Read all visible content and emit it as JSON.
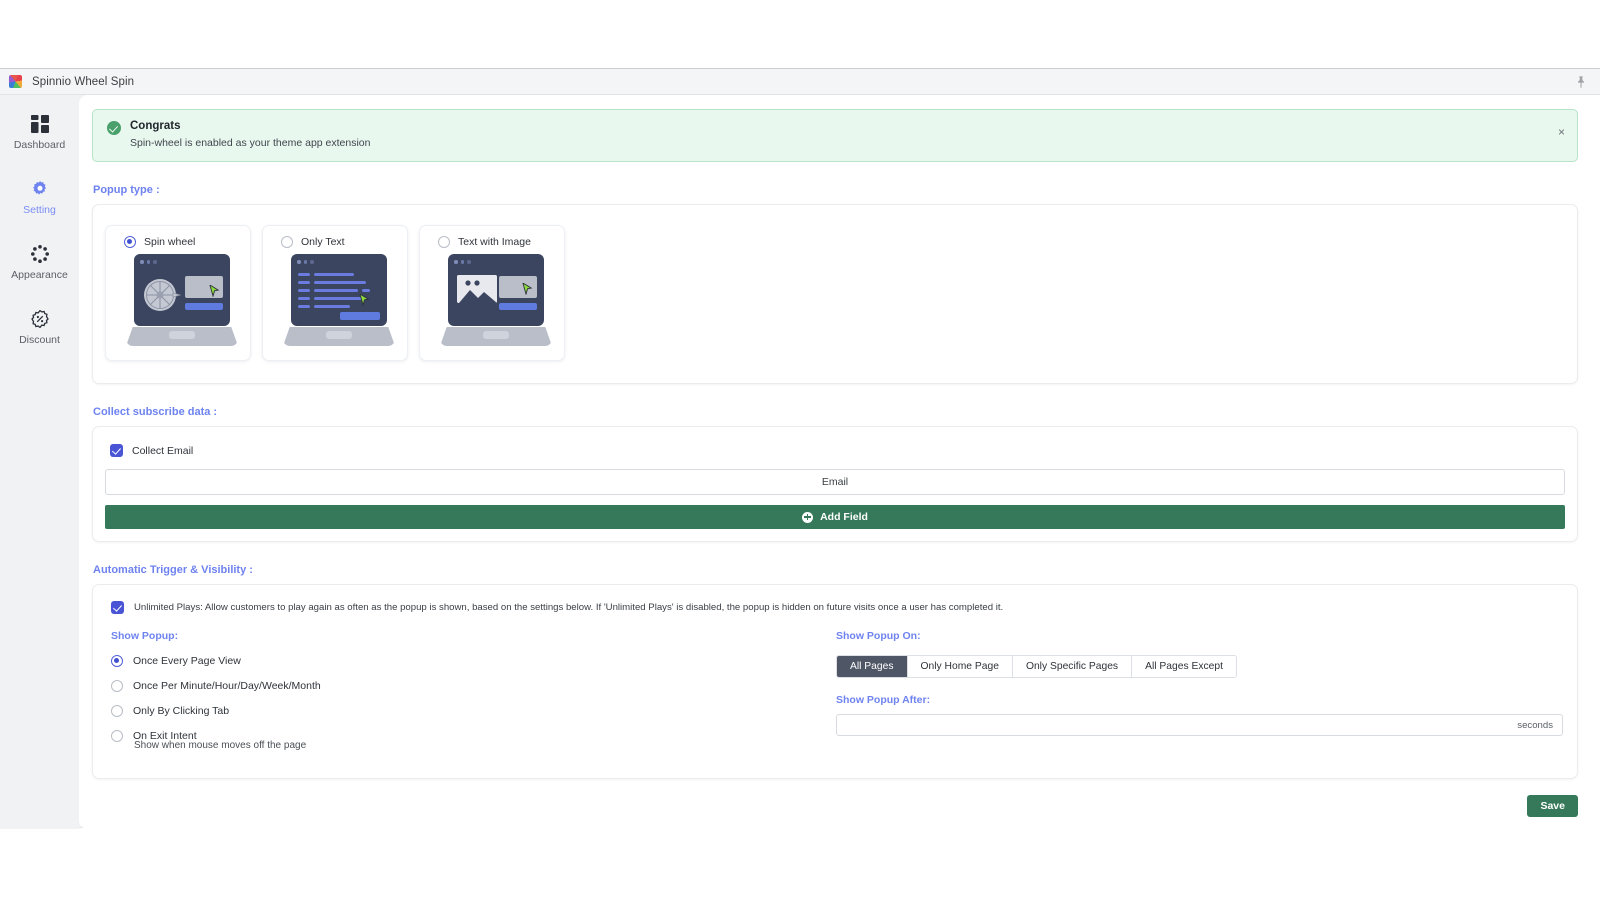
{
  "window": {
    "app_title": "Spinnio Wheel Spin",
    "logo_icon": "spinnio-logo-icon",
    "pin_icon": "pin-icon"
  },
  "sidebar": {
    "items": [
      {
        "label": "Dashboard",
        "icon": "dashboard-grid-icon",
        "active": false
      },
      {
        "label": "Setting",
        "icon": "gear-icon",
        "active": true
      },
      {
        "label": "Appearance",
        "icon": "appearance-dots-icon",
        "active": false
      },
      {
        "label": "Discount",
        "icon": "discount-badge-icon",
        "active": false
      }
    ]
  },
  "banner": {
    "icon": "success-check-icon",
    "title": "Congrats",
    "subtitle": "Spin-wheel is enabled as your theme app extension",
    "close_label": "×"
  },
  "popup_type": {
    "heading": "Popup type :",
    "options": [
      {
        "label": "Spin wheel",
        "selected": true,
        "illustration": "laptop-spin-wheel"
      },
      {
        "label": "Only Text",
        "selected": false,
        "illustration": "laptop-only-text"
      },
      {
        "label": "Text with Image",
        "selected": false,
        "illustration": "laptop-text-with-image"
      }
    ]
  },
  "collect": {
    "heading": "Collect subscribe data :",
    "collect_email_label": "Collect Email",
    "collect_email_checked": true,
    "email_field_value": "Email",
    "add_field_label": "Add Field",
    "add_field_icon": "plus-circle-icon"
  },
  "trigger": {
    "heading": "Automatic Trigger & Visibility :",
    "unlimited_checked": true,
    "unlimited_text": "Unlimited Plays: Allow customers to play again as often as the popup is shown, based on the settings below. If 'Unlimited Plays' is disabled, the popup is hidden on future visits once a user has completed it.",
    "show_popup_label": "Show Popup:",
    "show_popup_options": [
      {
        "label": "Once Every Page View",
        "selected": true
      },
      {
        "label": "Once Per Minute/Hour/Day/Week/Month",
        "selected": false
      },
      {
        "label": "Only By Clicking Tab",
        "selected": false
      },
      {
        "label": "On Exit Intent",
        "selected": false
      }
    ],
    "exit_intent_hint": "Show when mouse moves off the page",
    "show_popup_on_label": "Show Popup On:",
    "show_popup_on_options": [
      {
        "label": "All Pages",
        "active": true
      },
      {
        "label": "Only Home Page",
        "active": false
      },
      {
        "label": "Only Specific Pages",
        "active": false
      },
      {
        "label": "All Pages Except",
        "active": false
      }
    ],
    "show_popup_after_label": "Show Popup After:",
    "show_popup_after_value": "",
    "show_popup_after_unit": "seconds"
  },
  "footer": {
    "save_label": "Save"
  },
  "colors": {
    "accent_blue": "#6e82f0",
    "checkbox_blue": "#4a55d6",
    "green_button": "#35795a",
    "banner_bg": "#e9f8ef",
    "banner_border": "#b7e3c6",
    "segment_active": "#4f5666",
    "sidebar_bg": "#f1f2f4"
  }
}
